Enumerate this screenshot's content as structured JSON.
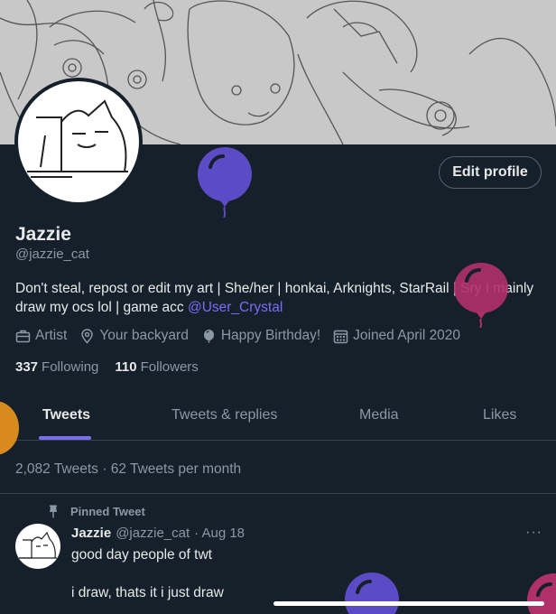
{
  "profile": {
    "name": "Jazzie",
    "handle": "@jazzie_cat",
    "edit_label": "Edit profile",
    "bio_text": "Don't steal, repost or edit my art | She/her | honkai, Arknights, StarRail | Sry I mainly draw my ocs lol | game acc ",
    "bio_mention": "@User_Crystal",
    "meta": {
      "profession": "Artist",
      "location": "Your backyard",
      "birthday": "Happy Birthday!",
      "joined": "Joined April 2020"
    },
    "following_count": "337",
    "following_label": "Following",
    "followers_count": "110",
    "followers_label": "Followers"
  },
  "tabs": [
    "Tweets",
    "Tweets & replies",
    "Media",
    "Likes"
  ],
  "active_tab": "Tweets",
  "stats": "2,082 Tweets · 62 Tweets per month",
  "pinned": {
    "label": "Pinned Tweet",
    "author": "Jazzie",
    "handle": "@jazzie_cat",
    "date": "· Aug 18",
    "more": "···",
    "line1": "good day people of twt",
    "line2": "i draw, thats it i just draw"
  },
  "colors": {
    "background": "#15202b",
    "accent": "#7b6cf6",
    "muted": "#8b98a5",
    "balloon_purple": "#5b4bc4",
    "balloon_magenta": "#b0306a",
    "balloon_orange": "#d98a1e"
  },
  "icons": [
    "briefcase-icon",
    "location-pin-icon",
    "balloon-icon",
    "calendar-icon",
    "pin-icon",
    "more-icon"
  ]
}
